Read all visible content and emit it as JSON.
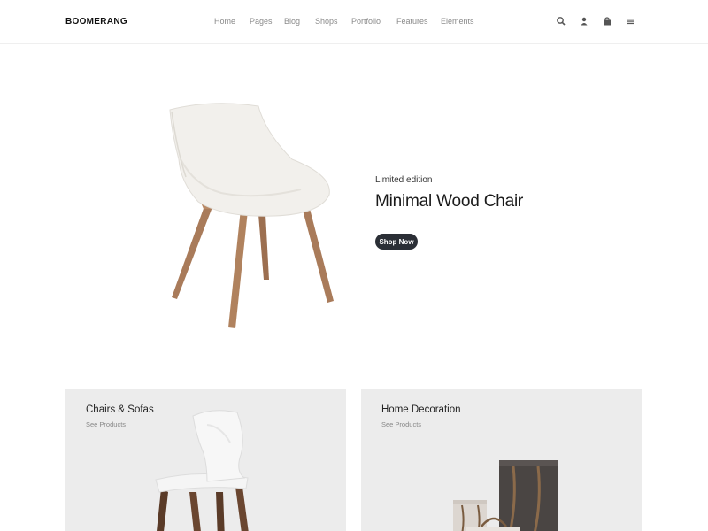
{
  "header": {
    "logo": "BOOMERANG",
    "nav": [
      "Home",
      "Pages",
      "Blog",
      "Shops",
      "Portfolio",
      "Features",
      "Elements"
    ],
    "icons": [
      "search-icon",
      "user-icon",
      "bag-icon",
      "menu-icon"
    ]
  },
  "hero": {
    "kicker": "Limited edition",
    "title": "Minimal Wood Chair",
    "button": "Shop Now"
  },
  "categories": [
    {
      "title": "Chairs & Sofas",
      "link": "See Products"
    },
    {
      "title": "Home Decoration",
      "link": "See Products"
    }
  ],
  "colors": {
    "button_bg": "#2b2f36",
    "card_bg": "#ececec",
    "nav_text": "#8a8a8a"
  }
}
